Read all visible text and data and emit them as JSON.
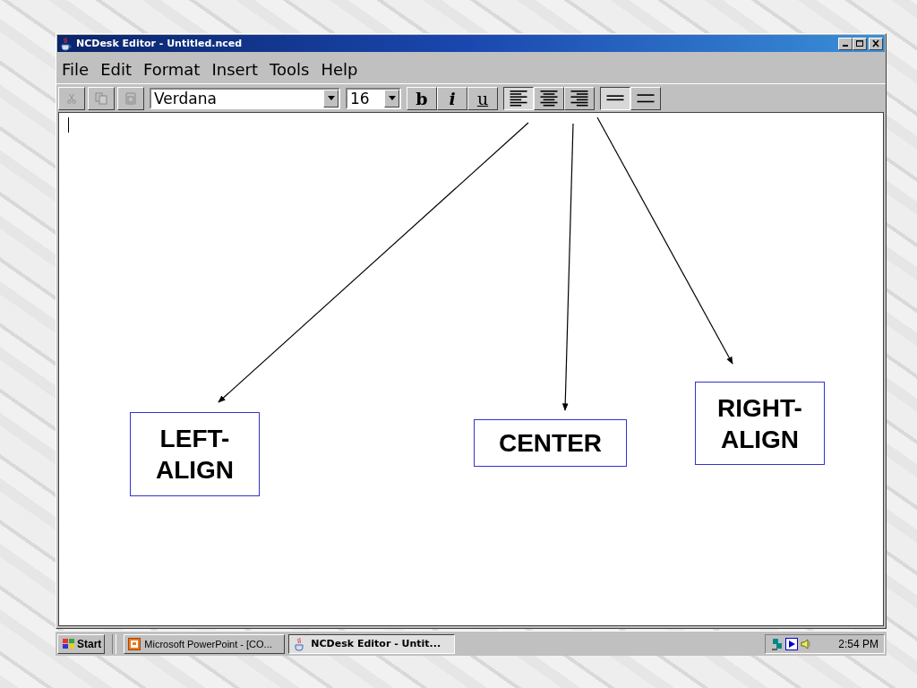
{
  "window": {
    "title": "NCDesk Editor - Untitled.nced"
  },
  "menu": [
    {
      "label": "File"
    },
    {
      "label": "Edit"
    },
    {
      "label": "Format"
    },
    {
      "label": "Insert"
    },
    {
      "label": "Tools"
    },
    {
      "label": "Help"
    }
  ],
  "toolbar": {
    "edit_buttons": [
      {
        "kind": "cut",
        "disabled": true
      },
      {
        "kind": "copy",
        "disabled": true
      },
      {
        "kind": "paste",
        "disabled": true
      }
    ],
    "font": {
      "value": "Verdana"
    },
    "size": {
      "value": "16"
    },
    "style_buttons": [
      {
        "label": "b",
        "kind": "bold",
        "selected": false
      },
      {
        "label": "i",
        "kind": "italic",
        "selected": false
      },
      {
        "label": "u",
        "kind": "underline",
        "selected": false
      }
    ],
    "align_buttons": [
      {
        "kind": "left",
        "selected": true
      },
      {
        "kind": "center",
        "selected": false
      },
      {
        "kind": "right",
        "selected": false
      }
    ],
    "spacing_buttons": [
      {
        "kind": "single",
        "selected": true
      },
      {
        "kind": "double",
        "selected": false
      }
    ]
  },
  "annotations": [
    {
      "text": "LEFT-ALIGN"
    },
    {
      "text": "CENTER"
    },
    {
      "text": "RIGHT-ALIGN"
    }
  ],
  "taskbar": {
    "start": "Start",
    "items": [
      {
        "label": "Microsoft PowerPoint - [CO...",
        "kind": "powerpoint",
        "selected": false
      },
      {
        "label": "NCDesk Editor - Untit...",
        "kind": "java",
        "selected": true
      }
    ],
    "clock": "2:54 PM"
  }
}
